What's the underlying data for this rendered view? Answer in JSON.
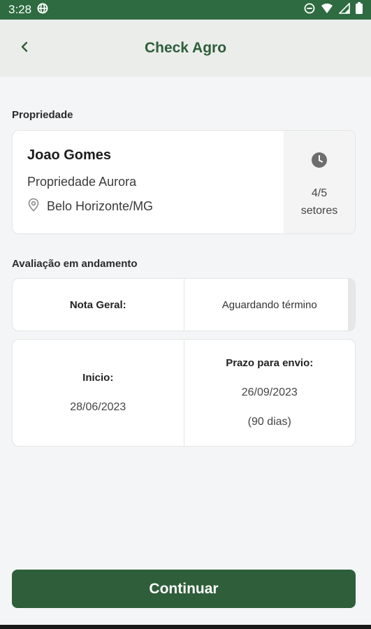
{
  "status_bar": {
    "time": "3:28",
    "icons": [
      "globe-icon",
      "do-not-disturb-icon",
      "wifi-icon",
      "signal-icon",
      "battery-icon"
    ]
  },
  "app_bar": {
    "title": "Check Agro",
    "back_icon": "chevron-left-icon"
  },
  "property_section": {
    "label": "Propriedade",
    "owner": "Joao Gomes",
    "property_name": "Propriedade Aurora",
    "location": "Belo Horizonte/MG",
    "location_icon": "location-pin-icon",
    "sectors_icon": "clock-icon",
    "sectors_progress": "4/5",
    "sectors_label": "setores"
  },
  "evaluation_section": {
    "label": "Avaliação em andamento",
    "nota_label": "Nota Geral:",
    "nota_value": "Aguardando término",
    "start_label": "Inicio:",
    "start_date": "28/06/2023",
    "deadline_label": "Prazo para envio:",
    "deadline_date": "26/09/2023",
    "deadline_days": "(90 dias)"
  },
  "actions": {
    "continue_label": "Continuar"
  },
  "colors": {
    "status_bar": "#2e6b40",
    "primary": "#2e5e3a",
    "app_bar_bg": "#ebedeb",
    "page_bg": "#f4f5f6"
  }
}
